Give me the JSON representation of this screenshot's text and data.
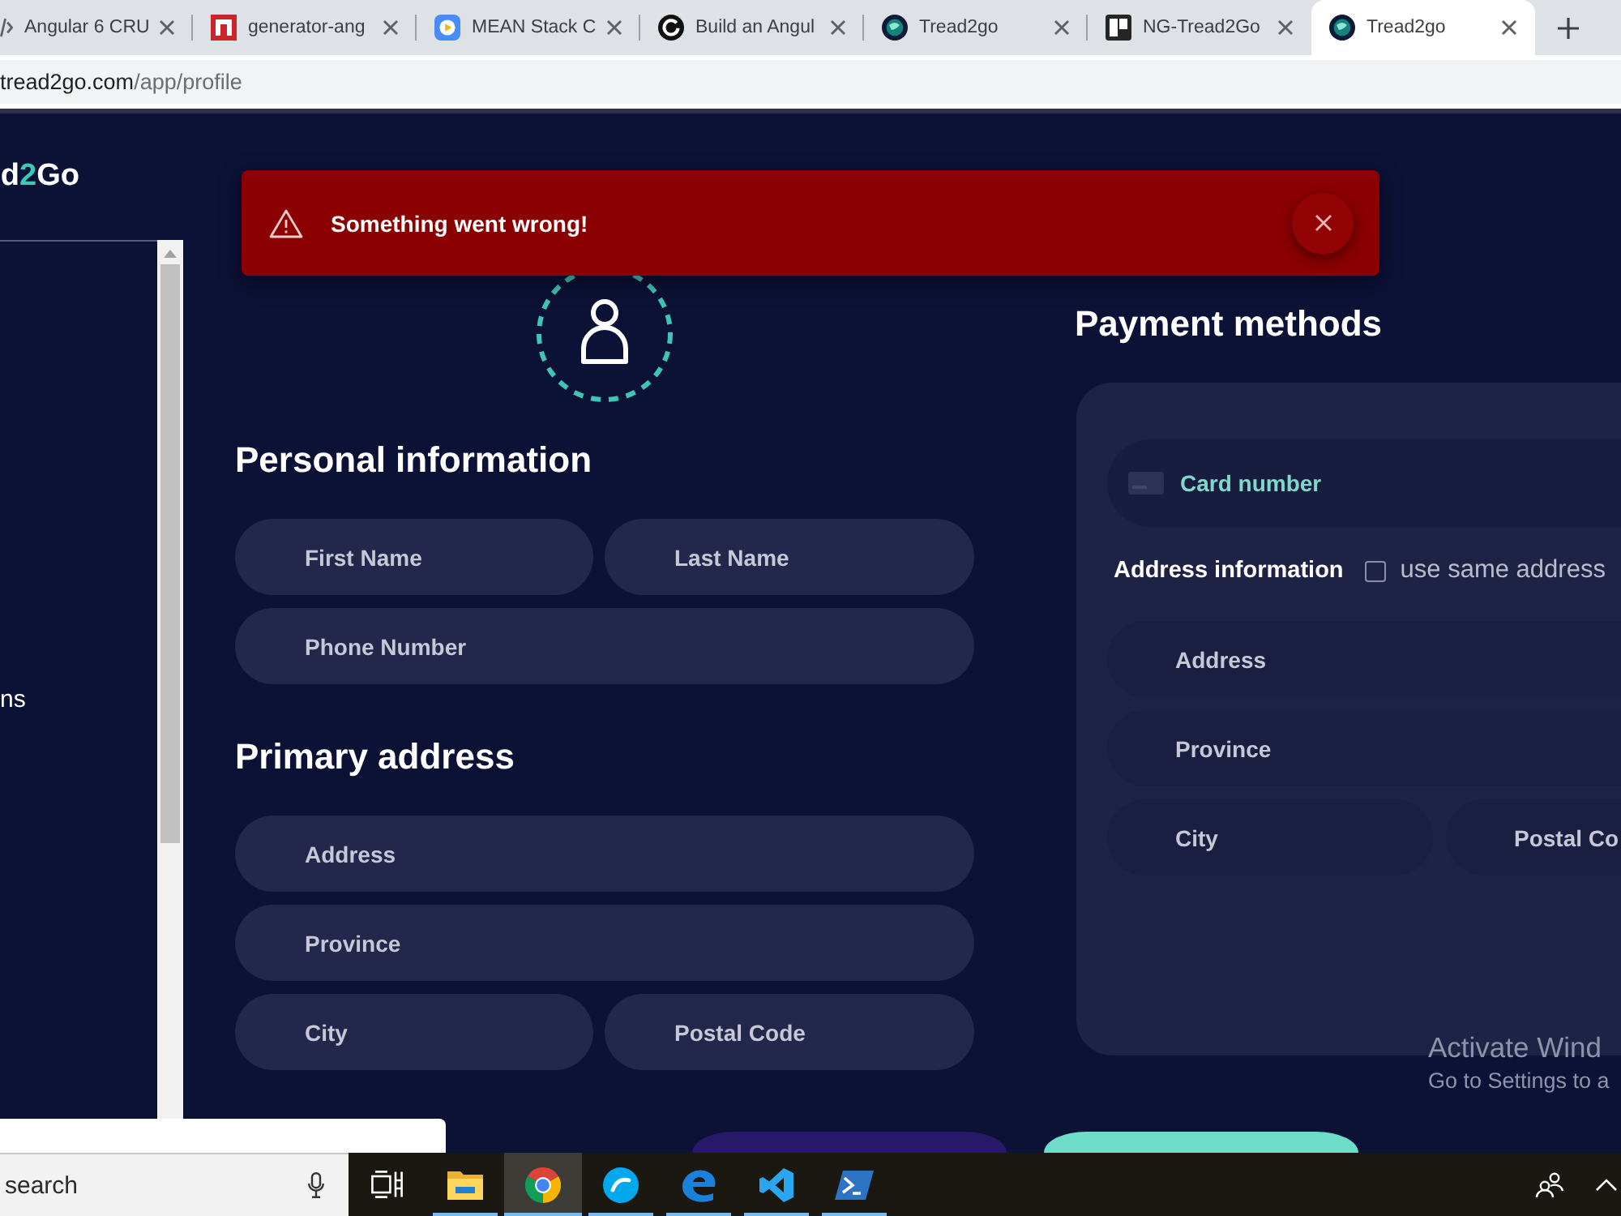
{
  "browser": {
    "tabs": [
      {
        "title": "Angular 6 CRU",
        "selected": false
      },
      {
        "title": "generator-ang",
        "selected": false
      },
      {
        "title": "MEAN Stack C",
        "selected": false
      },
      {
        "title": "Build an Angul",
        "selected": false
      },
      {
        "title": "Tread2go",
        "selected": false
      },
      {
        "title": "NG-Tread2Go",
        "selected": false
      },
      {
        "title": "Tread2go",
        "selected": true
      }
    ],
    "address": {
      "host": "tread2go.com",
      "path": "/app/profile"
    }
  },
  "sidebar": {
    "logo": {
      "before": "d",
      "accent": "2",
      "after": "Go"
    },
    "items": [
      {
        "label": "ns"
      }
    ]
  },
  "toast": {
    "message": "Something went wrong!"
  },
  "personal_information": {
    "heading": "Personal information",
    "rows": [
      [
        {
          "placeholder": "First Name"
        },
        {
          "placeholder": "Last Name"
        }
      ],
      [
        {
          "placeholder": "Phone Number"
        }
      ]
    ]
  },
  "primary_address": {
    "heading": "Primary address",
    "rows": [
      [
        {
          "placeholder": "Address"
        }
      ],
      [
        {
          "placeholder": "Province"
        }
      ],
      [
        {
          "placeholder": "City"
        },
        {
          "placeholder": "Postal Code"
        }
      ]
    ]
  },
  "payment_methods": {
    "heading": "Payment methods",
    "card_number": {
      "placeholder": "Card number"
    },
    "address_information": {
      "label": "Address information",
      "same_address": {
        "label": "use same address",
        "checked": false
      }
    },
    "rows": [
      [
        {
          "placeholder": "Address"
        }
      ],
      [
        {
          "placeholder": "Province"
        }
      ],
      [
        {
          "placeholder": "City"
        },
        {
          "placeholder": "Postal Co"
        }
      ]
    ]
  },
  "actions": [
    {
      "kind": "secondary"
    },
    {
      "kind": "primary"
    }
  ],
  "windows": {
    "activation": {
      "title": "Activate Wind",
      "subtitle": "Go to Settings to a"
    },
    "taskbar": {
      "search": {
        "placeholder": "search"
      },
      "apps": [
        {
          "running": false,
          "selected": false
        },
        {
          "running": true,
          "selected": false
        },
        {
          "running": true,
          "selected": true
        },
        {
          "running": true,
          "selected": false
        },
        {
          "running": true,
          "selected": false
        },
        {
          "running": true,
          "selected": false
        },
        {
          "running": true,
          "selected": false
        }
      ]
    }
  }
}
